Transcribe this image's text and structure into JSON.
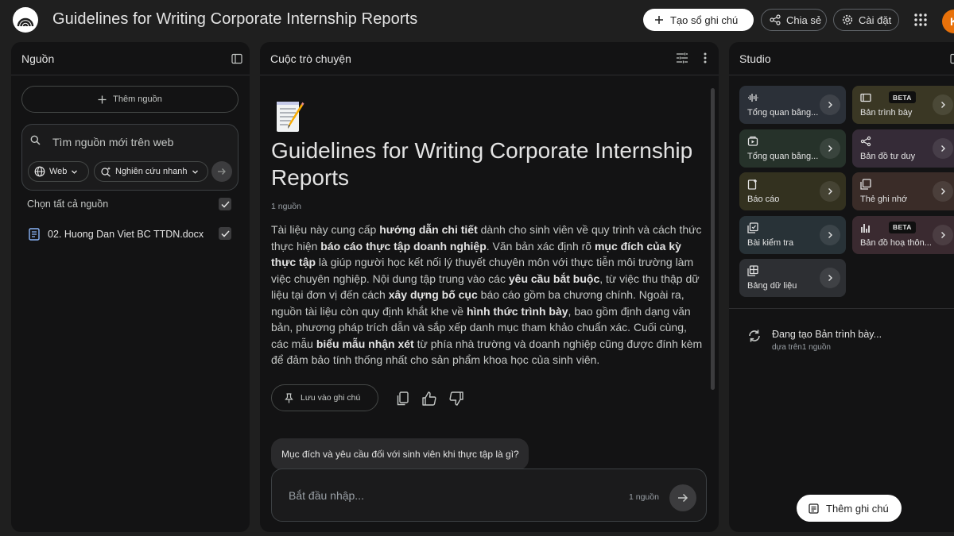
{
  "header": {
    "title": "Guidelines for Writing Corporate Internship Reports",
    "create_notebook": "Tạo sổ ghi chú",
    "share": "Chia sẻ",
    "settings": "Cài đặt",
    "avatar_initial": "K"
  },
  "sources_panel": {
    "title": "Nguồn",
    "add_source": "Thêm nguồn",
    "search_placeholder": "Tìm nguồn mới trên web",
    "chip_web": "Web",
    "chip_research": "Nghiên cứu nhanh",
    "select_all": "Chọn tất cả nguồn",
    "items": [
      {
        "name": "02. Huong Dan Viet BC TTDN.docx",
        "checked": true
      }
    ]
  },
  "chat_panel": {
    "title": "Cuộc trò chuyện",
    "doc_title": "Guidelines for Writing Corporate Internship Reports",
    "source_count": "1 nguồn",
    "summary": [
      {
        "t": "Tài liệu này cung cấp ",
        "b": false
      },
      {
        "t": "hướng dẫn chi tiết",
        "b": true
      },
      {
        "t": " dành cho sinh viên về quy trình và cách thức thực hiện ",
        "b": false
      },
      {
        "t": "báo cáo thực tập doanh nghiệp",
        "b": true
      },
      {
        "t": ". Văn bản xác định rõ ",
        "b": false
      },
      {
        "t": "mục đích của kỳ thực tập",
        "b": true
      },
      {
        "t": " là giúp người học kết nối lý thuyết chuyên môn với thực tiễn môi trường làm việc chuyên nghiệp. Nội dung tập trung vào các ",
        "b": false
      },
      {
        "t": "yêu cầu bắt buộc",
        "b": true
      },
      {
        "t": ", từ việc thu thập dữ liệu tại đơn vị đến cách ",
        "b": false
      },
      {
        "t": "xây dựng bố cục",
        "b": true
      },
      {
        "t": " báo cáo gồm ba chương chính. Ngoài ra, nguồn tài liệu còn quy định khắt khe về ",
        "b": false
      },
      {
        "t": "hình thức trình bày",
        "b": true
      },
      {
        "t": ", bao gồm định dạng văn bản, phương pháp trích dẫn và sắp xếp danh mục tham khảo chuẩn xác. Cuối cùng, các mẫu ",
        "b": false
      },
      {
        "t": "biểu mẫu nhận xét",
        "b": true
      },
      {
        "t": " từ phía nhà trường và doanh nghiệp cũng được đính kèm để đảm bảo tính thống nhất cho sản phẩm khoa học của sinh viên.",
        "b": false
      }
    ],
    "save_to_note": "Lưu vào ghi chú",
    "suggested_question": "Mục đích và yêu cầu đối với sinh viên khi thực tập là gì?",
    "input_placeholder": "Bắt đầu nhập...",
    "input_source_count": "1 nguồn"
  },
  "studio_panel": {
    "title": "Studio",
    "tiles": [
      {
        "label": "Tổng quan bằng...",
        "icon": "audio-waveform-icon",
        "color": "#2b3038",
        "beta": ""
      },
      {
        "label": "Bản trình bày",
        "icon": "slides-icon",
        "color": "#3a3724",
        "beta": "BETA"
      },
      {
        "label": "Tổng quan bằng...",
        "icon": "video-icon",
        "color": "#26322a",
        "beta": ""
      },
      {
        "label": "Bản đồ tư duy",
        "icon": "mind-map-icon",
        "color": "#352b37",
        "beta": ""
      },
      {
        "label": "Báo cáo",
        "icon": "report-icon",
        "color": "#33311f",
        "beta": ""
      },
      {
        "label": "Thẻ ghi nhớ",
        "icon": "flashcards-icon",
        "color": "#3a2c28",
        "beta": ""
      },
      {
        "label": "Bài kiểm tra",
        "icon": "quiz-icon",
        "color": "#283237",
        "beta": ""
      },
      {
        "label": "Bản đồ hoạ thôn...",
        "icon": "infographic-icon",
        "color": "#3a2a30",
        "beta": "BETA"
      },
      {
        "label": "Bảng dữ liệu",
        "icon": "data-table-icon",
        "color": "#2d2f33",
        "beta": ""
      }
    ],
    "generating_title": "Đang tạo Bản trình bày...",
    "generating_sub": "dựa trên1 nguồn",
    "add_note": "Thêm ghi chú"
  }
}
